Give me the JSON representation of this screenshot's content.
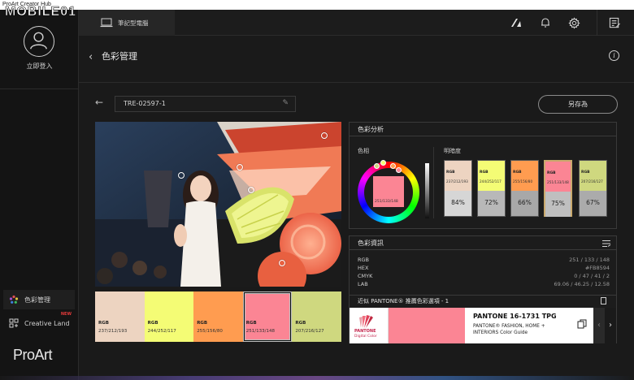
{
  "window": {
    "app_title": "ProArt Creator Hub"
  },
  "watermark": {
    "text": "MOBILE01"
  },
  "sidebar": {
    "login_label": "立即登入",
    "items": [
      {
        "label": "色彩管理",
        "icon": "color-palette-icon",
        "active": true
      },
      {
        "label": "Creative Land",
        "icon": "creative-land-icon",
        "badge": "NEW"
      }
    ],
    "brand": "ProArt"
  },
  "topbar": {
    "device_label": "筆記型電腦",
    "icons": [
      "proart-a-icon",
      "bell-icon",
      "gear-icon",
      "feedback-icon"
    ]
  },
  "header": {
    "title": "色彩管理"
  },
  "file": {
    "name": "TRE-02597-1",
    "save_label": "另存為"
  },
  "swatches": [
    {
      "label": "RGB",
      "rgb": "237/212/193",
      "hex": "#EDD4C1"
    },
    {
      "label": "RGB",
      "rgb": "244/252/117",
      "hex": "#F4FC75"
    },
    {
      "label": "RGB",
      "rgb": "255/156/80",
      "hex": "#FF9C50"
    },
    {
      "label": "RGB",
      "rgb": "251/133/148",
      "hex": "#FB8594",
      "selected": true
    },
    {
      "label": "RGB",
      "rgb": "207/216/127",
      "hex": "#CFD87F"
    }
  ],
  "analysis": {
    "title": "色彩分析",
    "hue_label": "色相",
    "lum_label": "明暗度",
    "hue_center": {
      "rgb": "251/133/148",
      "hex": "#FB8594"
    },
    "luminance": [
      {
        "label": "RGB",
        "rgb": "237/212/193",
        "hex": "#EDD4C1",
        "pct": "84%",
        "shade": "#d6d6d6"
      },
      {
        "label": "RGB",
        "rgb": "244/252/117",
        "hex": "#F4FC75",
        "pct": "72%",
        "shade": "#b8b8b8"
      },
      {
        "label": "RGB",
        "rgb": "255/156/80",
        "hex": "#FF9C50",
        "pct": "66%",
        "shade": "#a8a8a8"
      },
      {
        "label": "RGB",
        "rgb": "251/133/148",
        "hex": "#FB8594",
        "pct": "75%",
        "shade": "#bfbfbf",
        "selected": true
      },
      {
        "label": "RGB",
        "rgb": "207/216/127",
        "hex": "#CFD87F",
        "pct": "67%",
        "shade": "#ababab"
      }
    ]
  },
  "color_info": {
    "title": "色彩資訊",
    "rows": [
      {
        "key": "RGB",
        "value": "251 / 133 / 148"
      },
      {
        "key": "HEX",
        "value": "#FB8594"
      },
      {
        "key": "CMYK",
        "value": "0 / 47 / 41 / 2"
      },
      {
        "key": "LAB",
        "value": "69.06 / 46.25 / 12.58"
      }
    ]
  },
  "pantone": {
    "header": "近似 PANTONE® 推薦色彩選項 - 1",
    "logo_brand": "PANTONE",
    "logo_sub": "Digital Color",
    "name": "PANTONE 16-1731 TPG",
    "desc": "PANTONE® FASHION, HOME + INTERIORS Color Guide",
    "swatch_hex": "#FB8594",
    "prev": "‹",
    "next": "›"
  }
}
